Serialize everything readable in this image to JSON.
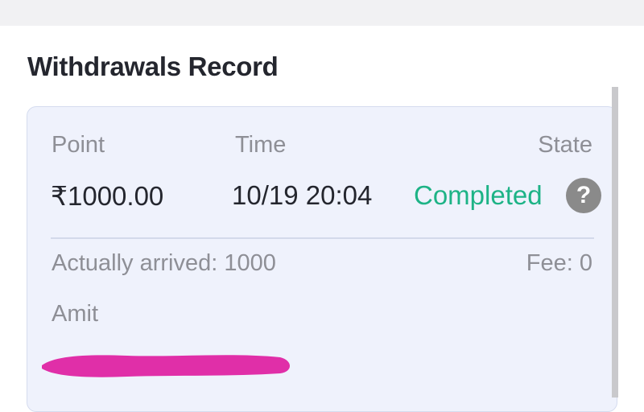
{
  "section": {
    "title": "Withdrawals Record"
  },
  "record": {
    "headers": {
      "point": "Point",
      "time": "Time",
      "state": "State"
    },
    "amount": "₹1000.00",
    "time": "10/19 20:04",
    "state": "Completed",
    "help_icon": "question-mark-icon",
    "actually_arrived": "Actually arrived: 1000",
    "fee": "Fee: 0",
    "name": "Amit"
  },
  "colors": {
    "card_background": "#eff2fc",
    "state_completed": "#1db386",
    "redaction_marker": "#e02fa8",
    "help_icon_background": "#8a8a8a"
  }
}
